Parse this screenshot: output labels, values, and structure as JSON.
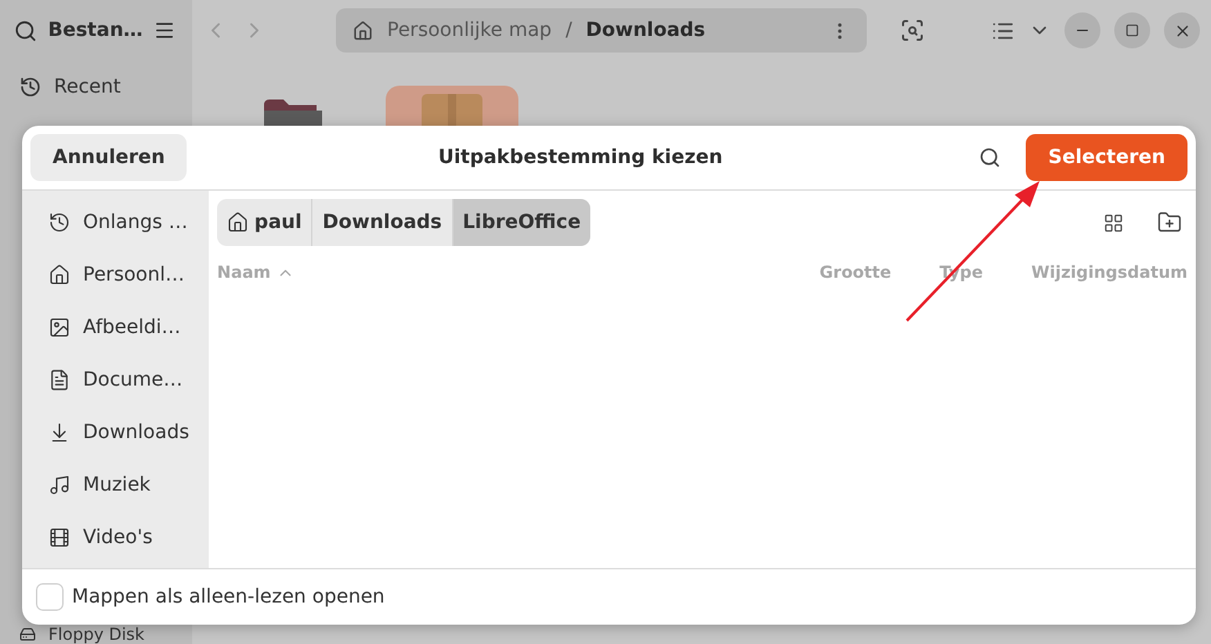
{
  "background_window": {
    "title": "Bestan…",
    "sidebar_items": [
      {
        "label": "Recent",
        "kind": "recent"
      },
      {
        "label": "Floppy Disk",
        "kind": "disk"
      }
    ],
    "path": [
      {
        "label": "Persoonlijke map",
        "kind": "home"
      },
      {
        "label": "Downloads",
        "kind": "folder"
      }
    ],
    "path_separator": "/"
  },
  "dialog": {
    "cancel": "Annuleren",
    "title": "Uitpakbestemming kiezen",
    "confirm": "Selecteren",
    "places": [
      {
        "label": "Onlangs …",
        "kind": "recent"
      },
      {
        "label": "Persoonl…",
        "kind": "home"
      },
      {
        "label": "Afbeeldi…",
        "kind": "pictures"
      },
      {
        "label": "Docume…",
        "kind": "documents"
      },
      {
        "label": "Downloads",
        "kind": "downloads"
      },
      {
        "label": "Muziek",
        "kind": "music"
      },
      {
        "label": "Video's",
        "kind": "videos"
      }
    ],
    "path": [
      {
        "label": "paul",
        "kind": "home",
        "selected": false
      },
      {
        "label": "Downloads",
        "kind": "folder",
        "selected": false
      },
      {
        "label": "LibreOffice",
        "kind": "folder",
        "selected": true
      }
    ],
    "columns": [
      {
        "label": "Naam",
        "sorted": true
      },
      {
        "label": "Grootte",
        "sorted": false
      },
      {
        "label": "Type",
        "sorted": false
      },
      {
        "label": "Wijzigingsdatum",
        "sorted": false
      }
    ],
    "read_only_option": {
      "label": "Mappen als alleen-lezen openen",
      "checked": false
    }
  }
}
